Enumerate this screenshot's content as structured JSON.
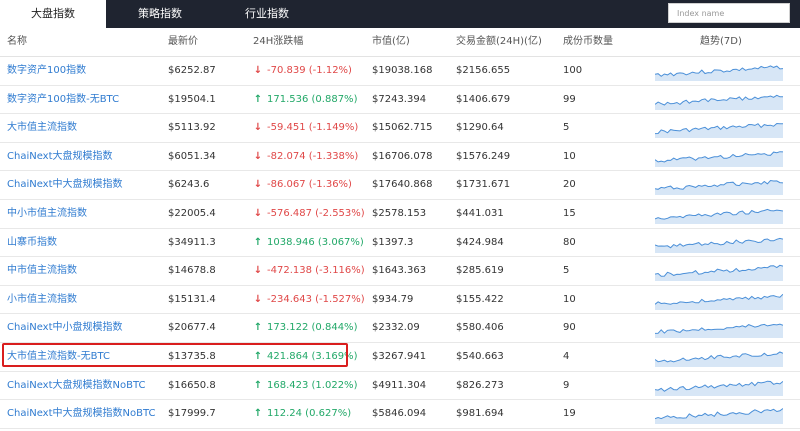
{
  "tabs": [
    "大盘指数",
    "策略指数",
    "行业指数"
  ],
  "search": {
    "placeholder": "Index name"
  },
  "columns": [
    "名称",
    "最新价",
    "24H涨跌幅",
    "市值(亿)",
    "交易金额(24H)(亿)",
    "成份币数量",
    "趋势(7D)"
  ],
  "colors": {
    "up": "#22a868",
    "down": "#e04848",
    "link": "#2f7bd0",
    "sparkline": "#4a8fd8",
    "highlight": "#d91e1e"
  },
  "rows": [
    {
      "name": "数字资产100指数",
      "price": "$6252.87",
      "change": "-70.839 (-1.12%)",
      "direction": "down",
      "market_cap": "$19038.168",
      "volume": "$2156.655",
      "constituents": "100"
    },
    {
      "name": "数字资产100指数-无BTC",
      "price": "$19504.1",
      "change": "171.536 (0.887%)",
      "direction": "up",
      "market_cap": "$7243.394",
      "volume": "$1406.679",
      "constituents": "99"
    },
    {
      "name": "大市值主流指数",
      "price": "$5113.92",
      "change": "-59.451 (-1.149%)",
      "direction": "down",
      "market_cap": "$15062.715",
      "volume": "$1290.64",
      "constituents": "5"
    },
    {
      "name": "ChaiNext大盘规模指数",
      "price": "$6051.34",
      "change": "-82.074 (-1.338%)",
      "direction": "down",
      "market_cap": "$16706.078",
      "volume": "$1576.249",
      "constituents": "10"
    },
    {
      "name": "ChaiNext中大盘规模指数",
      "price": "$6243.6",
      "change": "-86.067 (-1.36%)",
      "direction": "down",
      "market_cap": "$17640.868",
      "volume": "$1731.671",
      "constituents": "20"
    },
    {
      "name": "中小市值主流指数",
      "price": "$22005.4",
      "change": "-576.487 (-2.553%)",
      "direction": "down",
      "market_cap": "$2578.153",
      "volume": "$441.031",
      "constituents": "15"
    },
    {
      "name": "山寨币指数",
      "price": "$34911.3",
      "change": "1038.946 (3.067%)",
      "direction": "up",
      "market_cap": "$1397.3",
      "volume": "$424.984",
      "constituents": "80"
    },
    {
      "name": "中市值主流指数",
      "price": "$14678.8",
      "change": "-472.138 (-3.116%)",
      "direction": "down",
      "market_cap": "$1643.363",
      "volume": "$285.619",
      "constituents": "5"
    },
    {
      "name": "小市值主流指数",
      "price": "$15131.4",
      "change": "-234.643 (-1.527%)",
      "direction": "down",
      "market_cap": "$934.79",
      "volume": "$155.422",
      "constituents": "10"
    },
    {
      "name": "ChaiNext中小盘规模指数",
      "price": "$20677.4",
      "change": "173.122 (0.844%)",
      "direction": "up",
      "market_cap": "$2332.09",
      "volume": "$580.406",
      "constituents": "90"
    },
    {
      "name": "大市值主流指数-无BTC",
      "price": "$13735.8",
      "change": "421.864 (3.169%)",
      "direction": "up",
      "market_cap": "$3267.941",
      "volume": "$540.663",
      "constituents": "4",
      "highlighted": true
    },
    {
      "name": "ChaiNext大盘规模指数NoBTC",
      "price": "$16650.8",
      "change": "168.423 (1.022%)",
      "direction": "up",
      "market_cap": "$4911.304",
      "volume": "$826.273",
      "constituents": "9"
    },
    {
      "name": "ChaiNext中大盘规模指数NoBTC",
      "price": "$17999.7",
      "change": "112.24 (0.627%)",
      "direction": "up",
      "market_cap": "$5846.094",
      "volume": "$981.694",
      "constituents": "19"
    }
  ]
}
